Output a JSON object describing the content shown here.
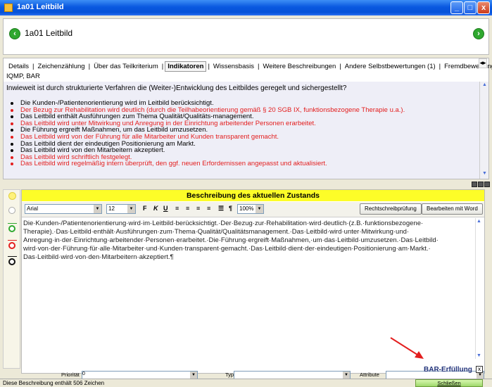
{
  "window": {
    "title": "1a01 Leitbild",
    "min": "_",
    "max": "□",
    "close": "x"
  },
  "header": {
    "title": "1a01 Leitbild",
    "prev_icon": "‹",
    "next_icon": "›"
  },
  "tabs": [
    "Details",
    "Zeichenzählung",
    "Über das Teilkriterium",
    "Indikatoren",
    "Wissensbasis",
    "Weitere Beschreibungen",
    "Andere Selbstbewertungen (1)",
    "Fremdbewertung"
  ],
  "tab_separator": "|",
  "active_tab": "Indikatoren",
  "scope": "IQMP, BAR",
  "question": "Inwieweit ist durch strukturierte Verfahren die (Weiter-)Entwicklung des Leitbildes geregelt und sichergestellt?",
  "indicators": [
    {
      "text": "Die Kunden-/Patientenorientierung wird im Leitbild berücksichtigt.",
      "red": false
    },
    {
      "text": "Der Bezug zur Rehabilitation wird deutlich (durch die Teilhabeorientierung gemäß § 20 SGB IX, funktionsbezogene Therapie u.a.).",
      "red": true
    },
    {
      "text": "Das Leitbild enthält Ausführungen zum Thema Qualität/Qualitäts-management.",
      "red": false
    },
    {
      "text": "Das Leitbild wird unter Mitwirkung und Anregung in der Einrichtung arbeitender Personen erarbeitet.",
      "red": true
    },
    {
      "text": "Die Führung ergreift Maßnahmen, um das Leitbild umzusetzen.",
      "red": false
    },
    {
      "text": "Das Leitbild wird von der Führung für alle Mitarbeiter und Kunden transparent gemacht.",
      "red": true
    },
    {
      "text": "Das Leitbild dient der eindeutigen Positionierung am Markt.",
      "red": false
    },
    {
      "text": "Das Leitbild wird von den Mitarbeitern akzeptiert.",
      "red": false
    },
    {
      "text": "Das Leitbild wird schriftlich festgelegt.",
      "red": true
    },
    {
      "text": "Das Leitbild wird regelmäßig intern überprüft, den ggf. neuen Erfordernissen angepasst und aktualisiert.",
      "red": true
    }
  ],
  "editor": {
    "section_title": "Beschreibung des aktuellen Zustands",
    "font": "Arial",
    "size": "12",
    "bold": "F",
    "italic": "K",
    "underline": "U",
    "list_icon": "☰",
    "para_icon": "¶",
    "zoom": "100%",
    "spellcheck_label": "Rechtschreibprüfung",
    "word_edit_label": "Bearbeiten mit Word",
    "lines": [
      "Die·Kunden-/Patientenorientierung·wird·im·Leitbild·berücksichtigt.·Der·Bezug·zur·Rehabilitation·wird·deutlich·(z.B.·funktionsbezogene·",
      "Therapie).·Das·Leitbild·enthält·Ausführungen·zum·Thema·Qualität/Qualitätsmanagement.·Das·Leitbild·wird·unter·Mitwirkung·und·",
      "Anregung·in·der·Einrichtung·arbeitender·Personen·erarbeitet.·Die·Führung·ergreift·Maßnahmen,·um·das·Leitbild·umzusetzen.·Das·Leitbild·",
      "wird·von·der·Führung·für·alle·Mitarbeiter·und·Kunden·transparent·gemacht.·Das·Leitbild·dient·der·eindeutigen·Positionierung·am·Markt.·",
      "Das·Leitbild·wird·von·den·Mitarbeitern·akzeptiert.¶"
    ]
  },
  "fields": {
    "priority_label": "Priorität",
    "priority_value": "0",
    "type_label": "Typ",
    "type_value": "",
    "attribute_label": "Attribute",
    "attribute_value": ""
  },
  "bar_fulfillment": "BAR-Erfüllung",
  "bar_checked": "x",
  "status": "Diese Beschreibung enthält 506 Zeichen",
  "close_label": "Schließen",
  "colors": {
    "red": "#e31e1e",
    "yellow": "#fdfd28",
    "title_blue": "#0a58e0"
  }
}
